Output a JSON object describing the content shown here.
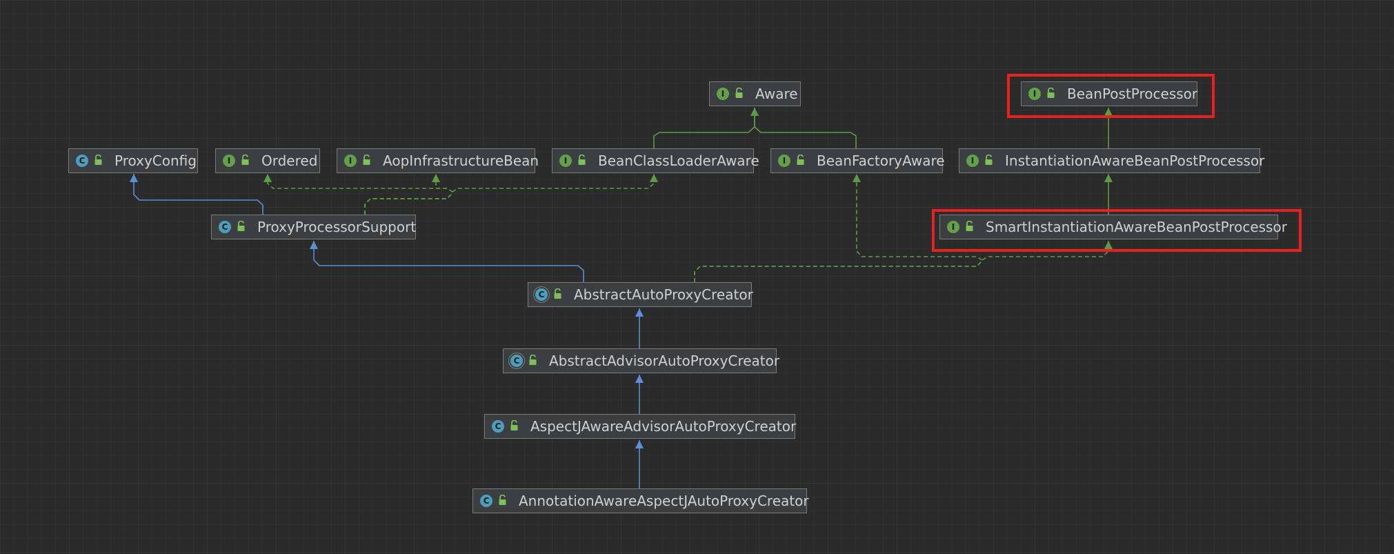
{
  "diagram": {
    "nodes": [
      {
        "id": "aware",
        "label": "Aware",
        "kind": "interface",
        "kind_letter": "I"
      },
      {
        "id": "bpp",
        "label": "BeanPostProcessor",
        "kind": "interface",
        "kind_letter": "I"
      },
      {
        "id": "proxyconfig",
        "label": "ProxyConfig",
        "kind": "class",
        "kind_letter": "C"
      },
      {
        "id": "ordered",
        "label": "Ordered",
        "kind": "interface",
        "kind_letter": "I"
      },
      {
        "id": "aopinfra",
        "label": "AopInfrastructureBean",
        "kind": "interface",
        "kind_letter": "I"
      },
      {
        "id": "bcla",
        "label": "BeanClassLoaderAware",
        "kind": "interface",
        "kind_letter": "I"
      },
      {
        "id": "bfa",
        "label": "BeanFactoryAware",
        "kind": "interface",
        "kind_letter": "I"
      },
      {
        "id": "iabpp",
        "label": "InstantiationAwareBeanPostProcessor",
        "kind": "interface",
        "kind_letter": "I"
      },
      {
        "id": "pps",
        "label": "ProxyProcessorSupport",
        "kind": "class",
        "kind_letter": "C"
      },
      {
        "id": "siabpp",
        "label": "SmartInstantiationAwareBeanPostProcessor",
        "kind": "interface",
        "kind_letter": "I"
      },
      {
        "id": "aapc",
        "label": "AbstractAutoProxyCreator",
        "kind": "abstract",
        "kind_letter": "C"
      },
      {
        "id": "aaapc",
        "label": "AbstractAdvisorAutoProxyCreator",
        "kind": "abstract",
        "kind_letter": "C"
      },
      {
        "id": "ajaapc",
        "label": "AspectJAwareAdvisorAutoProxyCreator",
        "kind": "class",
        "kind_letter": "C"
      },
      {
        "id": "aaajapc",
        "label": "AnnotationAwareAspectJAutoProxyCreator",
        "kind": "class",
        "kind_letter": "C"
      }
    ],
    "edges": [
      {
        "from": "bcla",
        "to": "aware",
        "type": "implements"
      },
      {
        "from": "bfa",
        "to": "aware",
        "type": "implements"
      },
      {
        "from": "iabpp",
        "to": "bpp",
        "type": "implements"
      },
      {
        "from": "siabpp",
        "to": "iabpp",
        "type": "implements"
      },
      {
        "from": "pps",
        "to": "proxyconfig",
        "type": "extends"
      },
      {
        "from": "pps",
        "to": "ordered",
        "type": "realizes"
      },
      {
        "from": "pps",
        "to": "aopinfra",
        "type": "realizes"
      },
      {
        "from": "pps",
        "to": "bcla",
        "type": "realizes"
      },
      {
        "from": "aapc",
        "to": "pps",
        "type": "extends"
      },
      {
        "from": "aapc",
        "to": "bfa",
        "type": "realizes"
      },
      {
        "from": "aapc",
        "to": "siabpp",
        "type": "realizes"
      },
      {
        "from": "aaapc",
        "to": "aapc",
        "type": "extends"
      },
      {
        "from": "ajaapc",
        "to": "aaapc",
        "type": "extends"
      },
      {
        "from": "aaajapc",
        "to": "ajaapc",
        "type": "extends"
      }
    ],
    "highlighted": [
      "bpp",
      "siabpp"
    ]
  },
  "colors": {
    "extends": "#5b8fd6",
    "implements": "#5f9a48",
    "realizes": "#5f9a48",
    "highlight": "#e8201f",
    "interface_icon": "#62a049",
    "class_icon": "#4b9fbd",
    "lock_icon": "#7fbf5a"
  }
}
